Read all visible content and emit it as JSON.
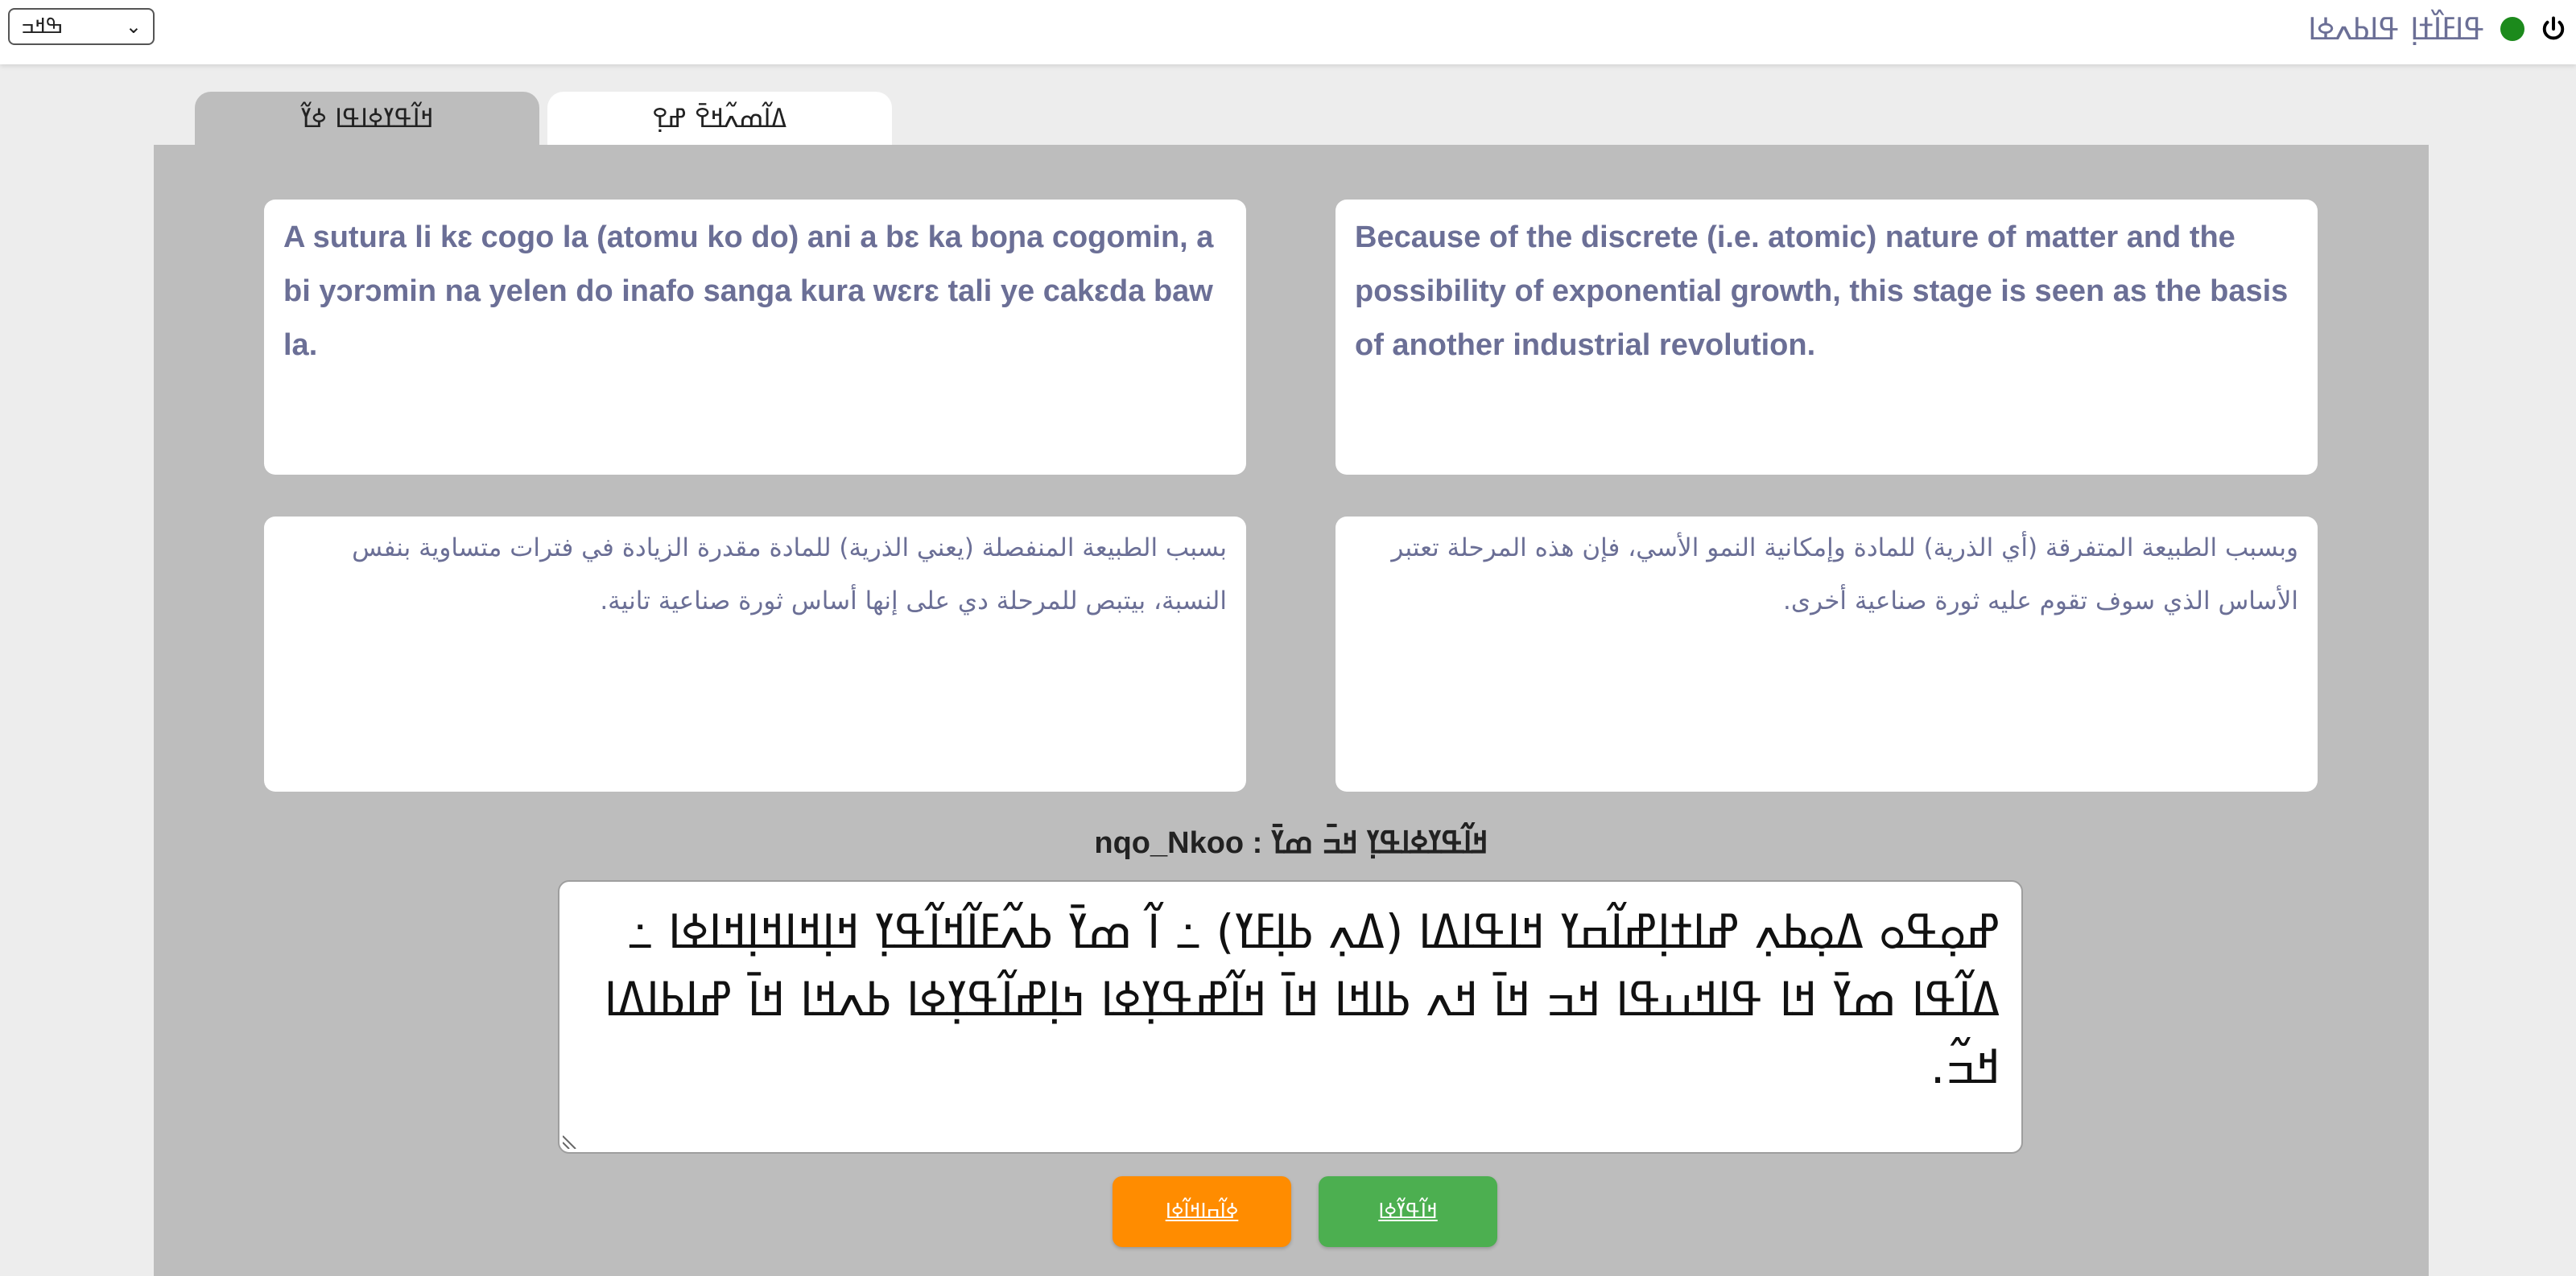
{
  "header": {
    "language_selected": "ߒߞߏ",
    "status_text": "ߟߊߓߊ߰ߙߊ߲ ߟߊߕߍߦߊ",
    "status_color": "#1c8a1c",
    "power_icon": "power-icon"
  },
  "tabs": [
    {
      "label": "ߞߊ߬ߟߌߦߊߟߊ ߦߌ߬",
      "active": true
    },
    {
      "label": "ߡߊ߬ߘߍ߬ߞߐ߫ ߝߐ߲"
    }
  ],
  "cards": {
    "source_bambara": "A sutura li kɛ cogo la (atomu ko do) ani a bɛ ka boɲa cogomin, a bi yɔrɔmin na yelen do inafo sanga kura wɛrɛ tali ye cakɛda baw la.",
    "source_english": "Because of the discrete (i.e. atomic) nature of matter and the possibility of exponential growth, this stage is seen as the basis of another industrial revolution.",
    "source_arabic_1": "بسبب الطبيعة المنفصلة (يعني الذرية) للمادة مقدرة الزيادة في فترات متساوية بنفس النسبة، بيتبص للمرحلة دي على إنها أساس ثورة صناعية تانية.",
    "source_arabic_2": "وبسبب الطبيعة المتفرقة (أي الذرية) للمادة وإمكانية النمو الأسي، فإن هذه المرحلة تعتبر الأساس الذي سوف تقوم عليه ثورة صناعية أخرى."
  },
  "input": {
    "label": "nqo_Nkoo  :  ߞߊ߬ߟߌߦߊߟߌ߲ ߞߏ߫ ߘߌ߫",
    "text": "ߝߋ߲ߟߋ ߡߋ߲ߕߍ߲ ߝߊߙߊ߲ߝߊ߬ߛߌ ߞߊߟߊߡߊ (ߡߍ߲ ߕߊ߲ߓߌ) ߸ ߊ߬ ߘߌ߫ ߕߍ߬ߓߊ߬ߞߊ߬ߟߌ߲ ߞߊ߲ߞߊߞߊ߲ߞߊߦߊ ߸ ߡߊ߬ߟߊ ߘߌ߫ ߞߊ ߟߊߞߎߟߊ ߞߏ ߞߊ߫ ߞߍ ߕߊߞߊ ߞߊ߫ ߞߊ߬ߝߟߌ߲ߦߊ ߤߊ߲ߝߊ߬ߟߌ߲ߦߊ ߕߍߞߊ ߞߊ߫ ߝߊߕߊߡߊ ߞߏ߬."
  },
  "buttons": {
    "orange_label": "ߦߊ߬ߛߊߞߊ߬ߦߊ",
    "green_label": "ߞߊ߬ߟߌ߬ߦߊ"
  }
}
